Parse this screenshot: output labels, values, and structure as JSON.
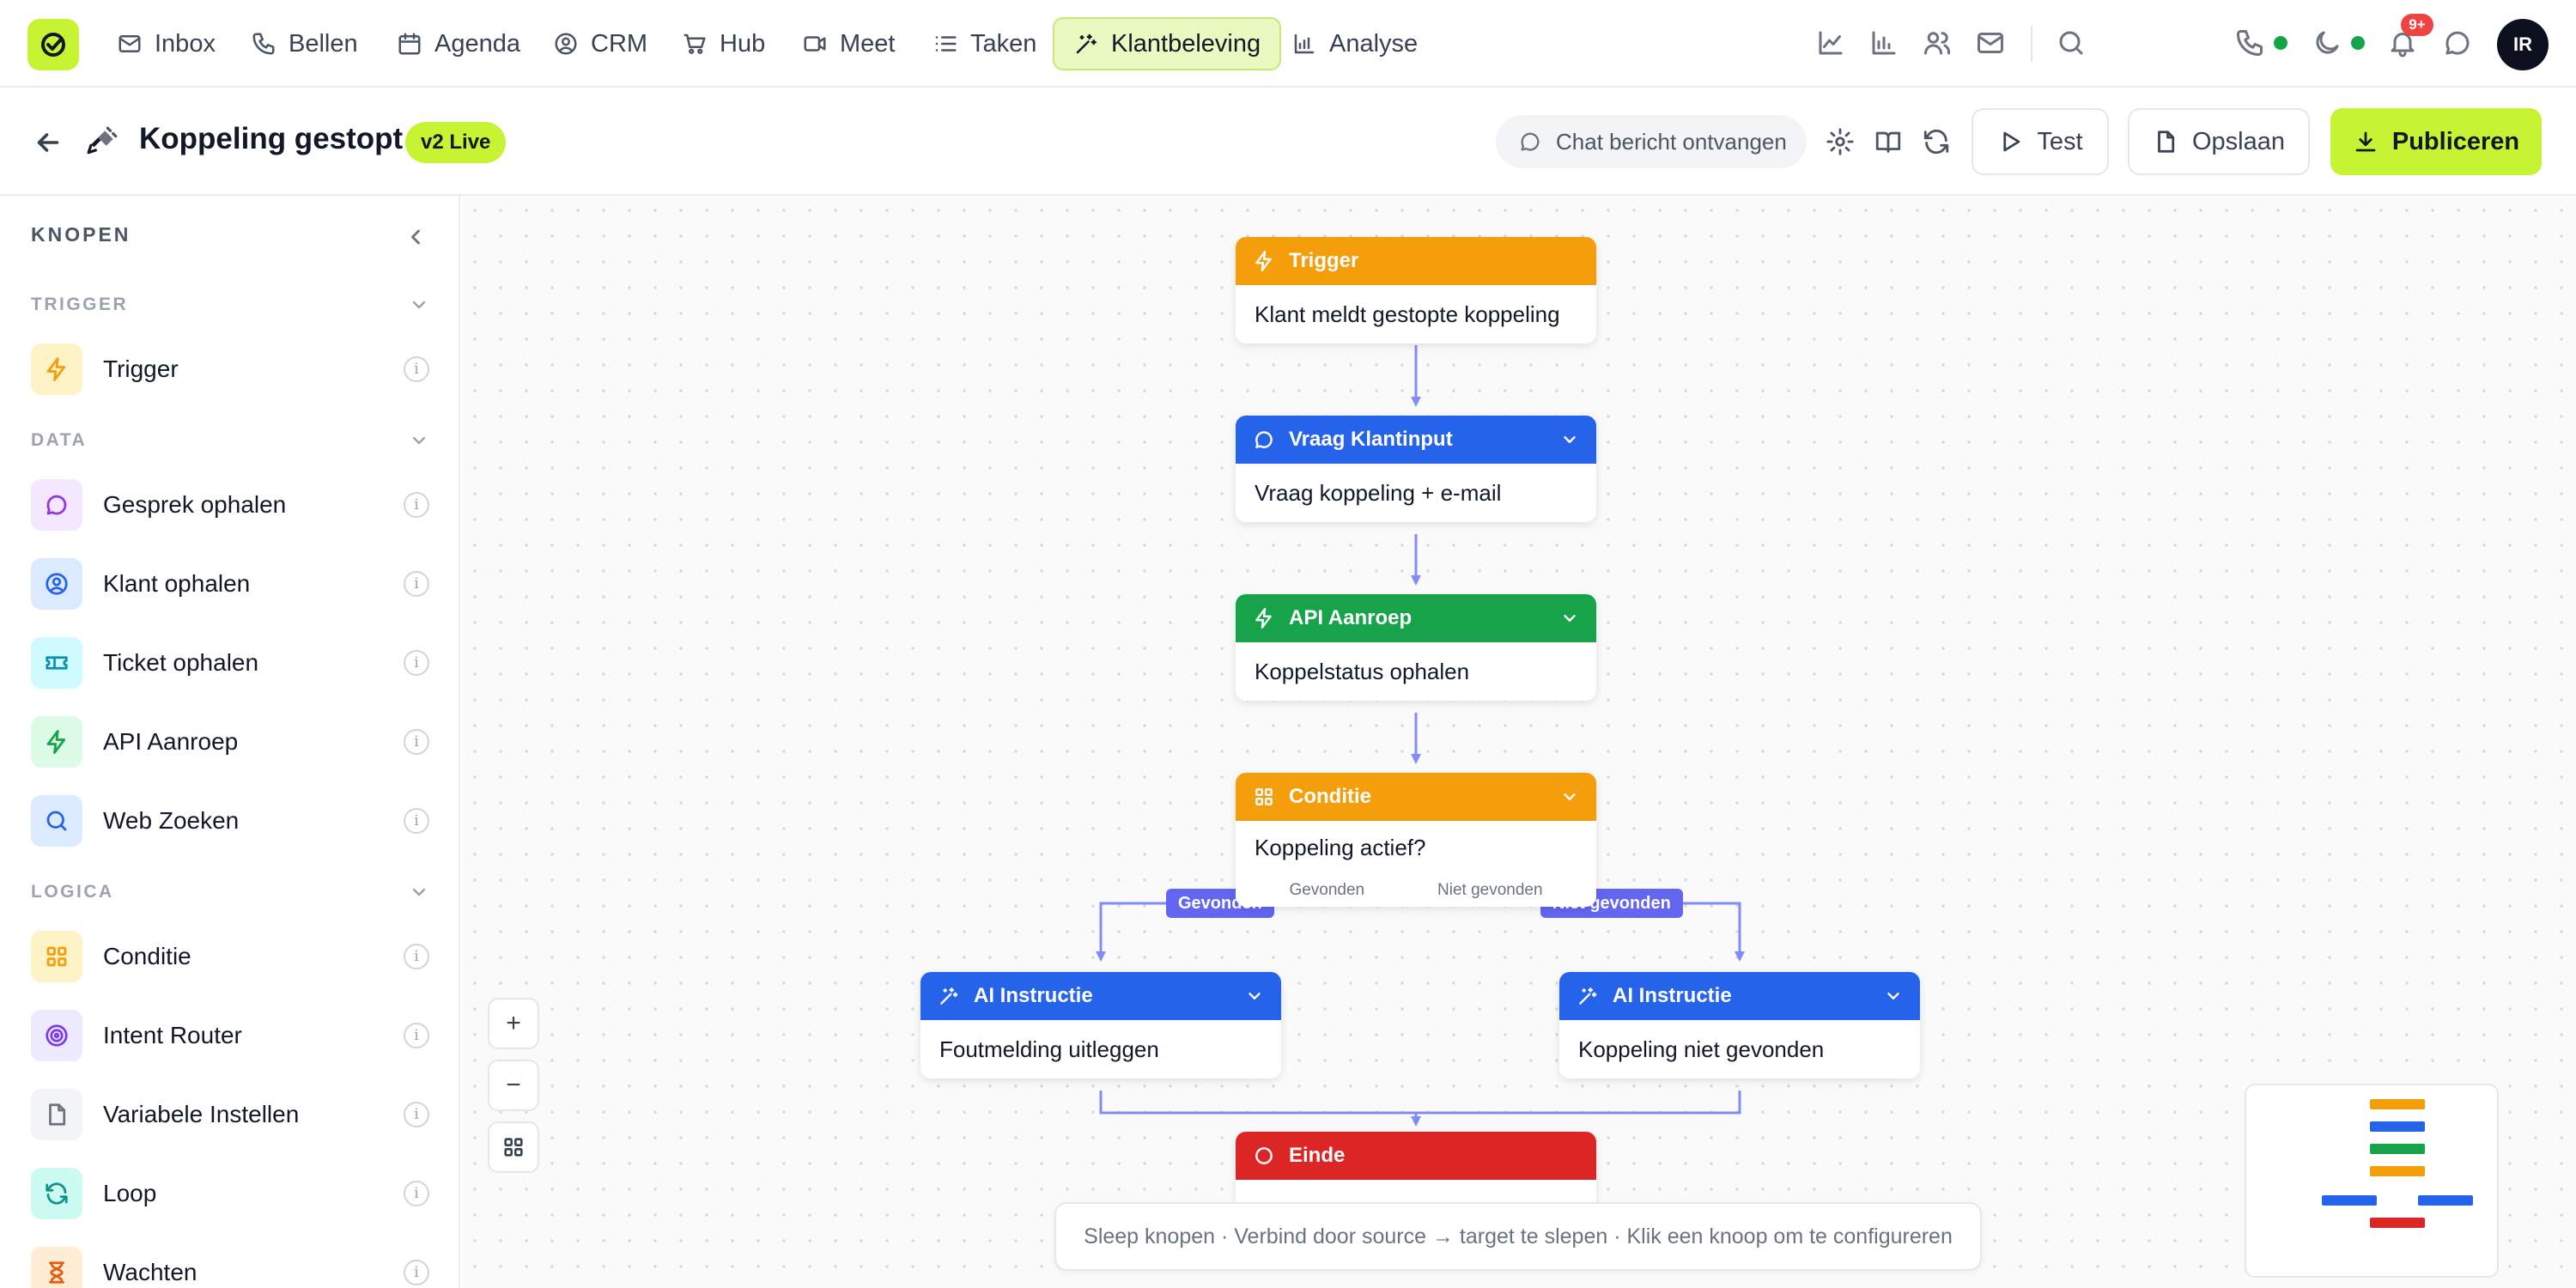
{
  "nav": {
    "items": [
      {
        "label": "Inbox",
        "icon": "mail-icon"
      },
      {
        "label": "Bellen",
        "icon": "phone-icon"
      },
      {
        "label": "Agenda",
        "icon": "calendar-icon"
      },
      {
        "label": "CRM",
        "icon": "user-circle-icon"
      },
      {
        "label": "Hub",
        "icon": "cart-icon"
      },
      {
        "label": "Meet",
        "icon": "video-icon"
      },
      {
        "label": "Taken",
        "icon": "list-icon"
      },
      {
        "label": "Klantbeleving",
        "icon": "sparkle-wand-icon",
        "active": true
      },
      {
        "label": "Analyse",
        "icon": "bar-chart-icon"
      }
    ],
    "notification_count": "9+",
    "avatar_initials": "IR",
    "accent_color": "#c6f432"
  },
  "toolbar": {
    "title": "Koppeling gestopt",
    "version_badge": "v2 Live",
    "trigger_pill": "Chat bericht ontvangen",
    "test_label": "Test",
    "save_label": "Opslaan",
    "publish_label": "Publiceren"
  },
  "sidebar": {
    "title": "KNOPEN",
    "sections": {
      "trigger": "TRIGGER",
      "data": "DATA",
      "logica": "LOGICA"
    },
    "items": [
      {
        "label": "Trigger",
        "icon": "bolt-icon",
        "color": "#f59e0b"
      },
      {
        "label": "Gesprek ophalen",
        "icon": "chat-bubble-icon",
        "color": "#9333ea"
      },
      {
        "label": "Klant ophalen",
        "icon": "user-circle-icon",
        "color": "#2563eb"
      },
      {
        "label": "Ticket ophalen",
        "icon": "ticket-icon",
        "color": "#0891b2"
      },
      {
        "label": "API Aanroep",
        "icon": "bolt-icon",
        "color": "#16a34a"
      },
      {
        "label": "Web Zoeken",
        "icon": "search-icon",
        "color": "#2563eb"
      },
      {
        "label": "Conditie",
        "icon": "grid-icon",
        "color": "#f59e0b"
      },
      {
        "label": "Intent Router",
        "icon": "target-icon",
        "color": "#7c3aed"
      },
      {
        "label": "Variabele Instellen",
        "icon": "document-icon",
        "color": "#6b7280"
      },
      {
        "label": "Loop",
        "icon": "refresh-icon",
        "color": "#0d9488"
      },
      {
        "label": "Wachten",
        "icon": "hourglass-icon",
        "color": "#ea580c"
      }
    ],
    "info_glyph": "i"
  },
  "flow": {
    "nodes": {
      "trigger": {
        "title": "Trigger",
        "body": "Klant meldt gestopte koppeling"
      },
      "input": {
        "title": "Vraag Klantinput",
        "body": "Vraag koppeling + e-mail"
      },
      "api": {
        "title": "API Aanroep",
        "body": "Koppelstatus ophalen"
      },
      "condition": {
        "title": "Conditie",
        "body": "Koppeling actief?",
        "out_found": "Gevonden",
        "out_not_found": "Niet gevonden"
      },
      "ai_left": {
        "title": "AI Instructie",
        "body": "Foutmelding uitleggen"
      },
      "ai_right": {
        "title": "AI Instructie",
        "body": "Koppeling niet gevonden"
      },
      "end": {
        "title": "Einde"
      }
    },
    "edge_labels": {
      "found": "Gevonden",
      "not_found": "Niet gevonden"
    },
    "edge_color": "#818cf8"
  },
  "canvas_controls": {
    "zoom_in": "+",
    "zoom_out": "−"
  },
  "hint": "Sleep knopen · Verbind door source → target te slepen · Klik een knoop om te configureren"
}
